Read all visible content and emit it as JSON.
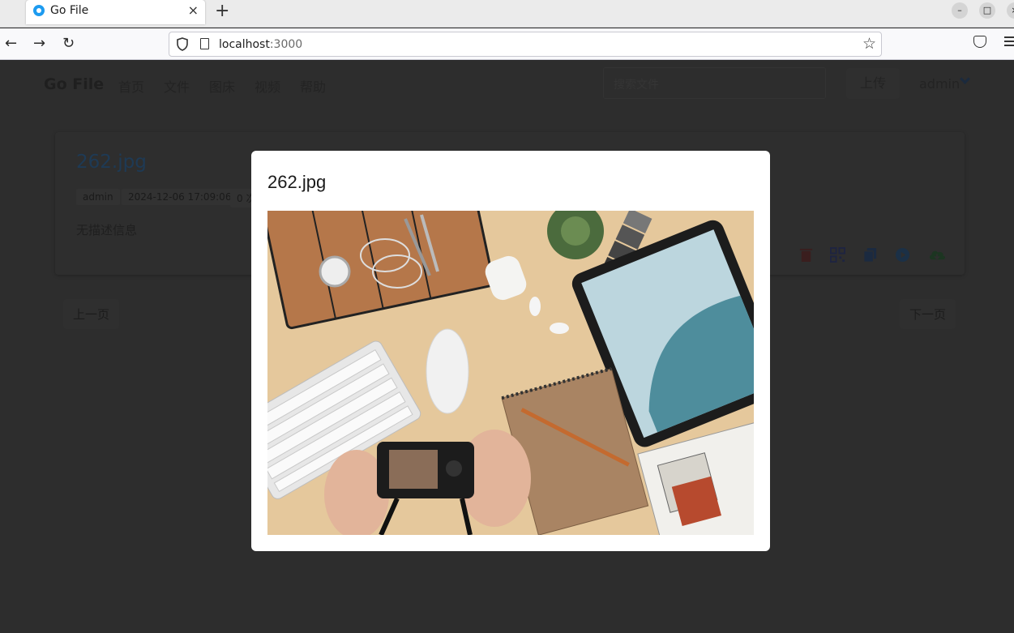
{
  "browser": {
    "tab_title": "Go File",
    "tab_close": "×",
    "new_tab": "+",
    "url_host": "localhost",
    "url_port": ":3000",
    "window_controls": [
      "–",
      "□",
      "×"
    ]
  },
  "header": {
    "brand": "Go File",
    "menu": [
      "首页",
      "文件",
      "图床",
      "视频",
      "帮助"
    ],
    "search_placeholder": "搜索文件",
    "upload_label": "上传",
    "username": "admin"
  },
  "file_card": {
    "title": "262.jpg",
    "tags": [
      "admin",
      "2024-12-06 17:09:06",
      "0 次"
    ],
    "description": "无描述信息",
    "actions": [
      {
        "icon": "trash-icon",
        "color": "#e53935"
      },
      {
        "icon": "qrcode-icon",
        "color": "#3f51b5"
      },
      {
        "icon": "copy-icon",
        "color": "#1565c0"
      },
      {
        "icon": "play-icon",
        "color": "#1e88e5"
      },
      {
        "icon": "cloud-download-icon",
        "color": "#43a047"
      }
    ]
  },
  "pagination": {
    "prev": "上一页",
    "next": "下一页"
  },
  "modal": {
    "title": "262.jpg",
    "image_label": "262.jpg"
  },
  "colors": {
    "overlay": "#2b2b2b",
    "modal_bg": "#ffffff",
    "image_bg": "#e3c69a"
  }
}
